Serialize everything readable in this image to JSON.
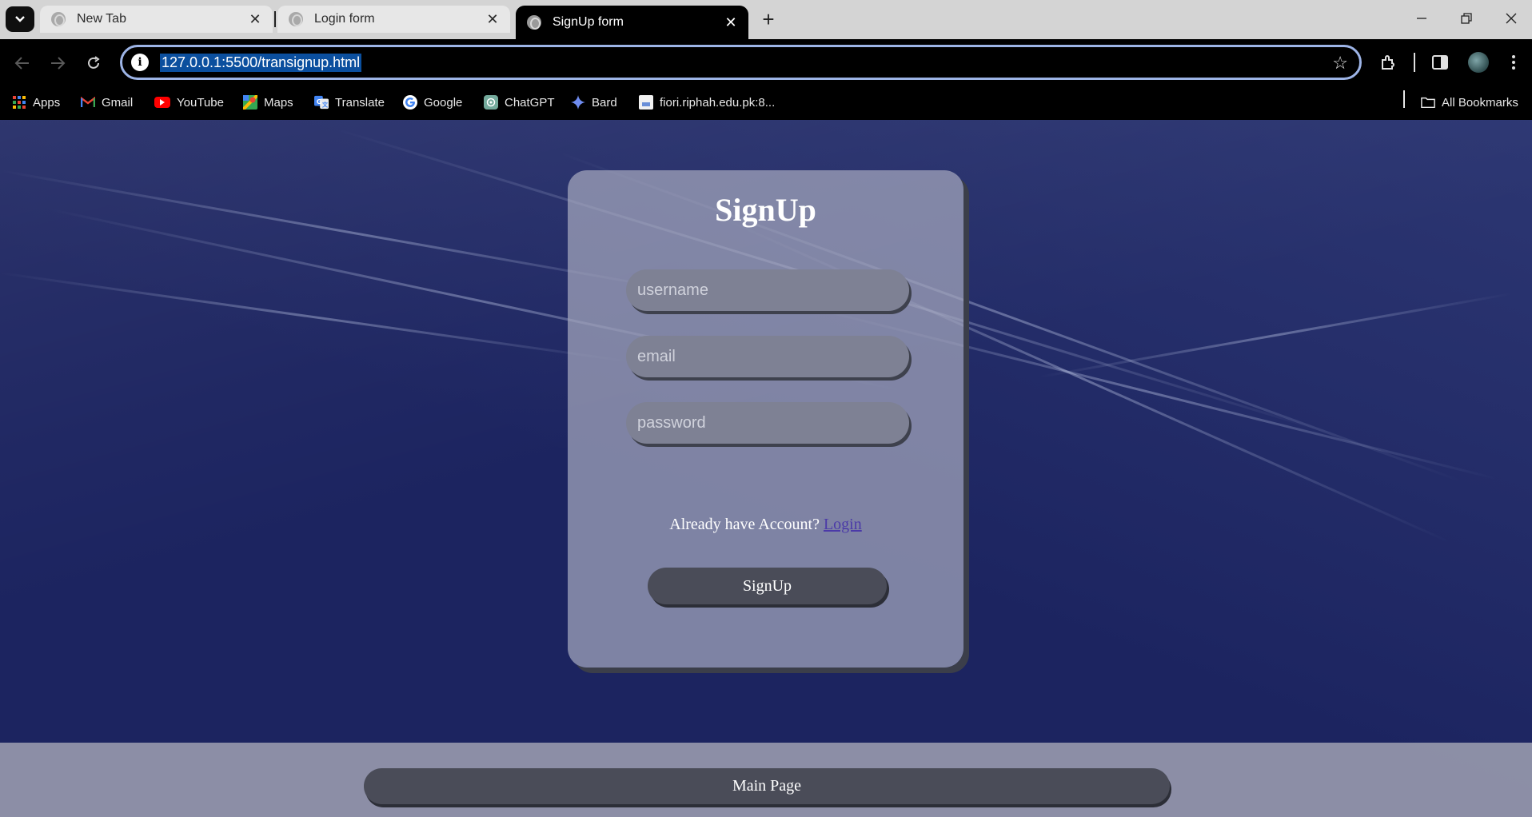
{
  "browser": {
    "tabs": [
      {
        "title": "New Tab",
        "active": false
      },
      {
        "title": "Login form",
        "active": false
      },
      {
        "title": "SignUp form",
        "active": true
      }
    ],
    "new_tab_symbol": "+",
    "close_symbol": "✕",
    "address": "127.0.0.1:5500/transignup.html",
    "bookmarks": [
      {
        "label": "Apps",
        "icon": "apps-grid-icon"
      },
      {
        "label": "Gmail",
        "icon": "gmail-icon"
      },
      {
        "label": "YouTube",
        "icon": "youtube-icon"
      },
      {
        "label": "Maps",
        "icon": "maps-icon"
      },
      {
        "label": "Translate",
        "icon": "translate-icon"
      },
      {
        "label": "Google",
        "icon": "google-icon"
      },
      {
        "label": "ChatGPT",
        "icon": "chatgpt-icon"
      },
      {
        "label": "Bard",
        "icon": "bard-icon"
      },
      {
        "label": "fiori.riphah.edu.pk:8...",
        "icon": "page-icon"
      }
    ],
    "all_bookmarks": "All Bookmarks"
  },
  "page": {
    "title": "SignUp",
    "fields": {
      "username_placeholder": "username",
      "email_placeholder": "email",
      "password_placeholder": "password"
    },
    "hint_text": "Already have Account?",
    "login_link": "Login",
    "signup_button": "SignUp",
    "main_page_button": "Main Page"
  },
  "colors": {
    "background": "#1c2460",
    "card": "#a5a8be",
    "button": "#4a4c58",
    "link": "#4b3aa8",
    "url_highlight": "#0b4f9e"
  }
}
